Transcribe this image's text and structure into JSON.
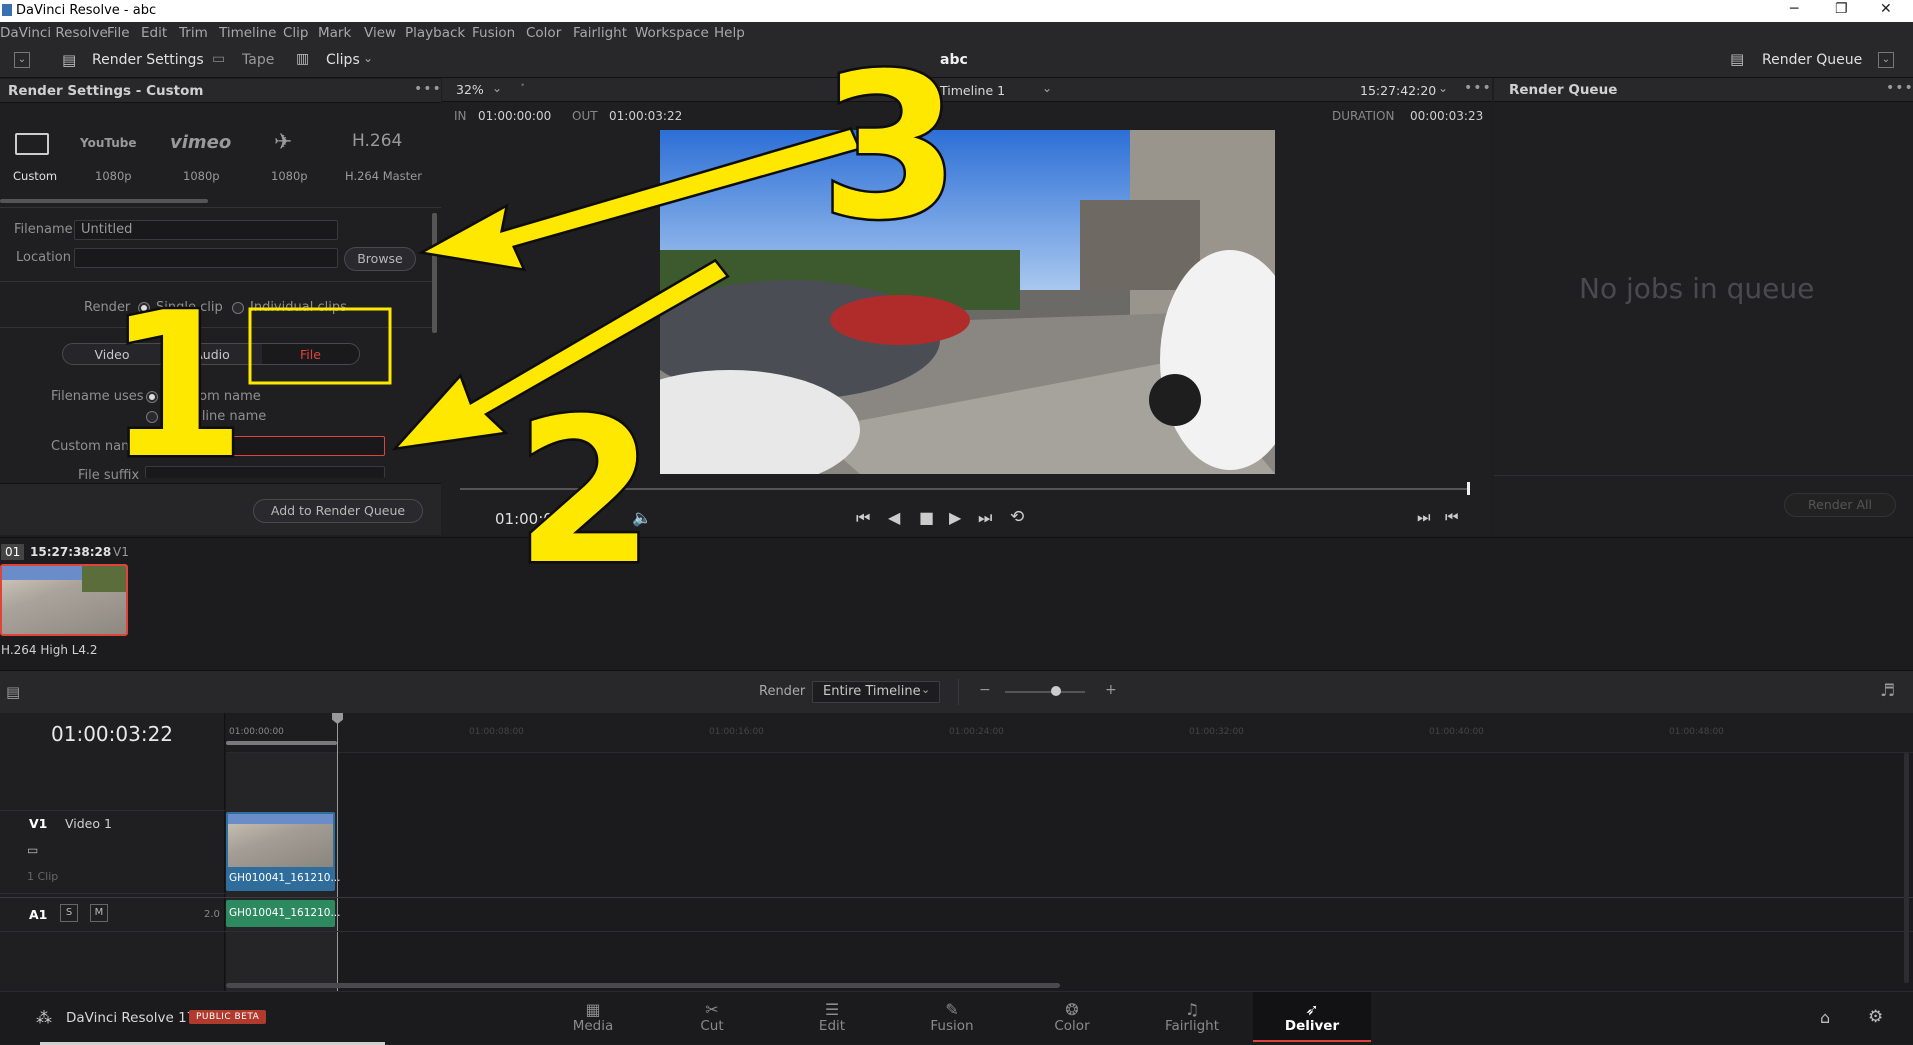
{
  "window": {
    "title": "DaVinci Resolve - abc"
  },
  "menu": [
    "DaVinci Resolve",
    "File",
    "Edit",
    "Trim",
    "Timeline",
    "Clip",
    "Mark",
    "View",
    "Playback",
    "Fusion",
    "Color",
    "Fairlight",
    "Workspace",
    "Help"
  ],
  "toolbar": {
    "render_settings": "Render Settings",
    "tape": "Tape",
    "clips": "Clips",
    "project_name": "abc",
    "render_queue": "Render Queue"
  },
  "render_settings": {
    "header": "Render Settings - Custom",
    "presets": [
      {
        "name": "Custom",
        "sub": "Custom"
      },
      {
        "name": "YouTube",
        "sub": "1080p"
      },
      {
        "name": "vimeo",
        "sub": "1080p"
      },
      {
        "name": "twitter",
        "sub": "1080p"
      },
      {
        "name": "H.264",
        "sub": "H.264 Master"
      }
    ],
    "filename_label": "Filename",
    "filename_value": "Untitled",
    "location_label": "Location",
    "location_value": "",
    "browse": "Browse",
    "render_label": "Render",
    "render_options": [
      "Single clip",
      "Individual clips"
    ],
    "tabs": [
      "Video",
      "Audio",
      "File"
    ],
    "filename_uses_label": "Filename uses",
    "filename_uses_options": [
      "Custom name",
      "Timeline name"
    ],
    "custom_name_label": "Custom name",
    "custom_name_value": "abc",
    "file_suffix_label": "File suffix",
    "add_to_queue": "Add to Render Queue"
  },
  "viewer": {
    "zoom": "32%",
    "timeline_name": "Timeline 1",
    "timecode": "15:27:42:20",
    "in_label": "IN",
    "in_value": "01:00:00:00",
    "out_label": "OUT",
    "out_value": "01:00:03:22",
    "duration_label": "DURATION",
    "duration_value": "00:00:03:23",
    "current_tc": "01:00:03:22"
  },
  "render_queue": {
    "header": "Render Queue",
    "empty": "No jobs in queue",
    "render_all": "Render All"
  },
  "clip_strip": {
    "index": "01",
    "timecode": "15:27:38:28",
    "track": "V1",
    "codec": "H.264 High L4.2"
  },
  "timeline": {
    "render_label": "Render",
    "render_mode": "Entire Timeline",
    "current_tc": "01:00:03:22",
    "ruler": [
      "01:00:00:00",
      "01:00:08:00",
      "01:00:16:00",
      "01:00:24:00",
      "01:00:32:00",
      "01:00:40:00",
      "01:00:48:00"
    ],
    "v1": {
      "id": "V1",
      "name": "Video 1",
      "clips": "1 Clip",
      "clip_name": "GH010041_161210..."
    },
    "a1": {
      "id": "A1",
      "s": "S",
      "m": "M",
      "level": "2.0",
      "clip_name": "GH010041_161210..."
    }
  },
  "app": {
    "name": "DaVinci Resolve 17",
    "badge": "PUBLIC BETA"
  },
  "pages": [
    {
      "name": "Media",
      "icon": "media-icon"
    },
    {
      "name": "Cut",
      "icon": "cut-icon"
    },
    {
      "name": "Edit",
      "icon": "edit-icon"
    },
    {
      "name": "Fusion",
      "icon": "fusion-icon"
    },
    {
      "name": "Color",
      "icon": "color-icon"
    },
    {
      "name": "Fairlight",
      "icon": "fairlight-icon"
    },
    {
      "name": "Deliver",
      "icon": "deliver-icon"
    }
  ],
  "annotations": [
    "1",
    "2",
    "3"
  ],
  "colors": {
    "accent_red": "#e0433a",
    "clip_blue": "#2f6e9c",
    "clip_green": "#2d8a60",
    "annotation_yellow": "#ffe800"
  }
}
